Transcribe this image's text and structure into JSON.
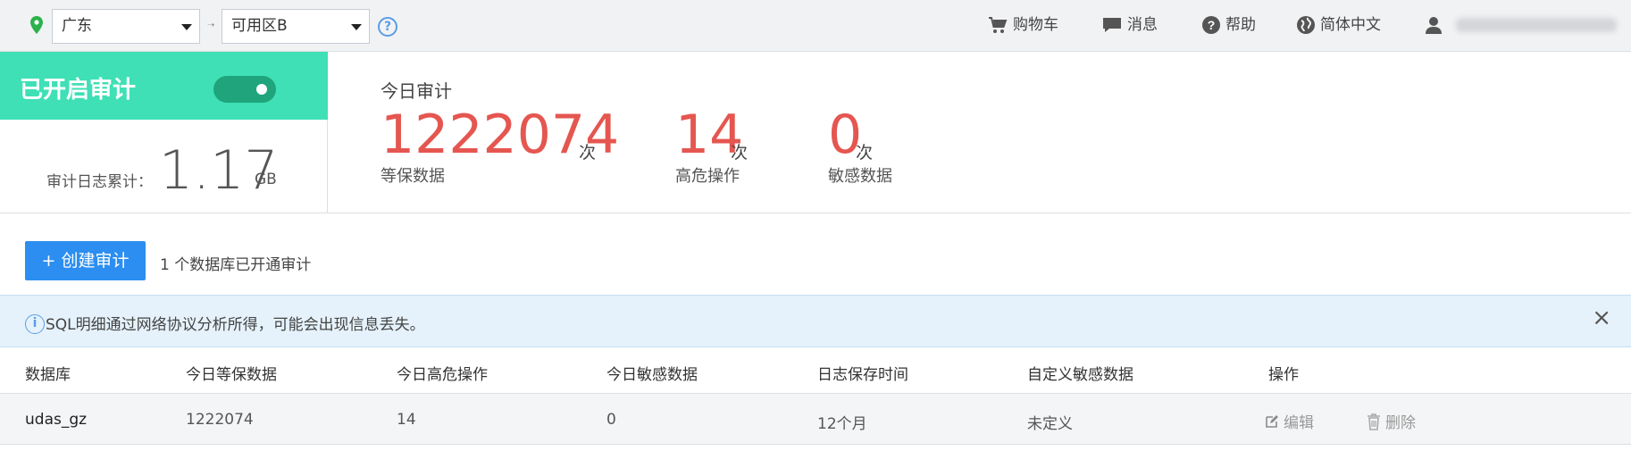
{
  "topbar": {
    "region_select": "广东",
    "zone_select": "可用区B",
    "help_glyph": "?",
    "nav": {
      "cart": "购物车",
      "messages": "消息",
      "help": "帮助",
      "language": "简体中文"
    }
  },
  "status": {
    "title": "已开启审计",
    "toggle_on": true,
    "log_label": "审计日志累计：",
    "log_value": "1.17",
    "log_unit": "GB"
  },
  "today": {
    "title": "今日审计",
    "stats": [
      {
        "value": "1222074",
        "unit": "次",
        "label": "等保数据"
      },
      {
        "value": "14",
        "unit": "次",
        "label": "高危操作"
      },
      {
        "value": "0",
        "unit": "次",
        "label": "敏感数据"
      }
    ]
  },
  "actions": {
    "create_label": "+ 创建审计",
    "db_count_text": "1 个数据库已开通审计"
  },
  "info": {
    "icon_glyph": "i",
    "text": "SQL明细通过网络协议分析所得，可能会出现信息丢失。",
    "close_glyph": "×"
  },
  "table": {
    "headers": [
      "数据库",
      "今日等保数据",
      "今日高危操作",
      "今日敏感数据",
      "日志保存时间",
      "自定义敏感数据",
      "操作"
    ],
    "rows": [
      {
        "db": "udas_gz",
        "level": "1222074",
        "high_risk": "14",
        "sensitive": "0",
        "retention": "12个月",
        "custom": "未定义",
        "edit": "编辑",
        "delete": "删除"
      }
    ]
  },
  "colors": {
    "accent": "#3fe0b6",
    "toggle": "#20a47c",
    "stat_red": "#e55650",
    "button_blue": "#2c8ef0",
    "info_bg": "#e5f2fb"
  }
}
